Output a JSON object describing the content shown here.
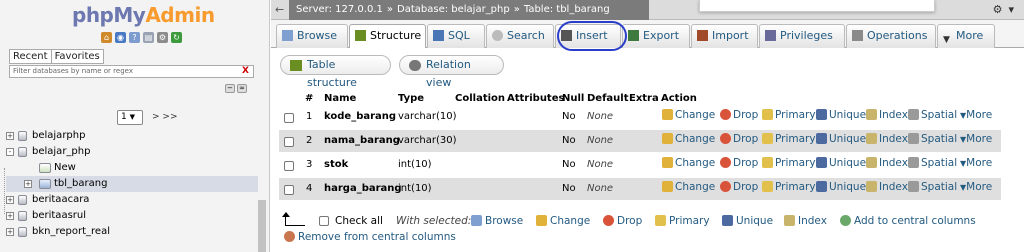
{
  "nav": {
    "logo_php": "php",
    "logo_my": "My",
    "logo_admin": "Admin",
    "tab_recent": "Recent",
    "tab_favorites": "Favorites",
    "filter_placeholder": "Filter databases by name or regex",
    "filter_clear": "X",
    "page_value": "1",
    "page_next": "> >>",
    "tree": [
      {
        "label": "belajarphp",
        "expander": "+",
        "selected": false,
        "child": false
      },
      {
        "label": "belajar_php",
        "expander": "-",
        "selected": false,
        "child": false
      },
      {
        "label": "New",
        "expander": "",
        "selected": false,
        "child": true
      },
      {
        "label": "tbl_barang",
        "expander": "+",
        "selected": true,
        "child": true
      },
      {
        "label": "beritaacara",
        "expander": "+",
        "selected": false,
        "child": false
      },
      {
        "label": "beritaasrul",
        "expander": "+",
        "selected": false,
        "child": false
      },
      {
        "label": "bkn_report_real",
        "expander": "+",
        "selected": false,
        "child": false
      }
    ]
  },
  "breadcrumb": {
    "server": "Server: 127.0.0.1",
    "database": "Database: belajar_php",
    "table": "Table: tbl_barang",
    "sep": "»"
  },
  "tabs": [
    {
      "label": "Browse",
      "icon": "browse-icon",
      "color": "#5b7fb8"
    },
    {
      "label": "Structure",
      "icon": "structure-icon",
      "color": "#6b8e23"
    },
    {
      "label": "SQL",
      "icon": "sql-icon",
      "color": "#4a76b5"
    },
    {
      "label": "Search",
      "icon": "search-icon",
      "color": "#888888"
    },
    {
      "label": "Insert",
      "icon": "insert-icon",
      "color": "#444444"
    },
    {
      "label": "Export",
      "icon": "export-icon",
      "color": "#3e7a3e"
    },
    {
      "label": "Import",
      "icon": "import-icon",
      "color": "#a04a2a"
    },
    {
      "label": "Privileges",
      "icon": "privileges-icon",
      "color": "#6a6a9a"
    },
    {
      "label": "Operations",
      "icon": "wrench-icon",
      "color": "#7a7a7a"
    },
    {
      "label": "More",
      "icon": "chevron-down-icon",
      "color": "#333333"
    }
  ],
  "sub_buttons": {
    "table_structure": "Table structure",
    "relation_view": "Relation view"
  },
  "columns": {
    "num": "#",
    "name": "Name",
    "type": "Type",
    "collation": "Collation",
    "attributes": "Attributes",
    "null": "Null",
    "default": "Default",
    "extra": "Extra",
    "action": "Action"
  },
  "rows": [
    {
      "num": "1",
      "name": "kode_barang",
      "type": "varchar(10)",
      "null": "No",
      "default": "None"
    },
    {
      "num": "2",
      "name": "nama_barang",
      "type": "varchar(30)",
      "null": "No",
      "default": "None"
    },
    {
      "num": "3",
      "name": "stok",
      "type": "int(10)",
      "null": "No",
      "default": "None"
    },
    {
      "num": "4",
      "name": "harga_barang",
      "type": "int(10)",
      "null": "No",
      "default": "None"
    }
  ],
  "row_actions": {
    "change": "Change",
    "drop": "Drop",
    "primary": "Primary",
    "unique": "Unique",
    "index": "Index",
    "spatial": "Spatial",
    "more": "More"
  },
  "bottom": {
    "check_all": "Check all",
    "with_selected": "With selected:",
    "browse": "Browse",
    "change": "Change",
    "drop": "Drop",
    "primary": "Primary",
    "unique": "Unique",
    "index": "Index",
    "add_central": "Add to central columns",
    "remove_central": "Remove from central columns"
  },
  "colors": {
    "link": "#235a81",
    "annotation": "#2a3ec9",
    "row_alt": "#dfdfdf"
  }
}
